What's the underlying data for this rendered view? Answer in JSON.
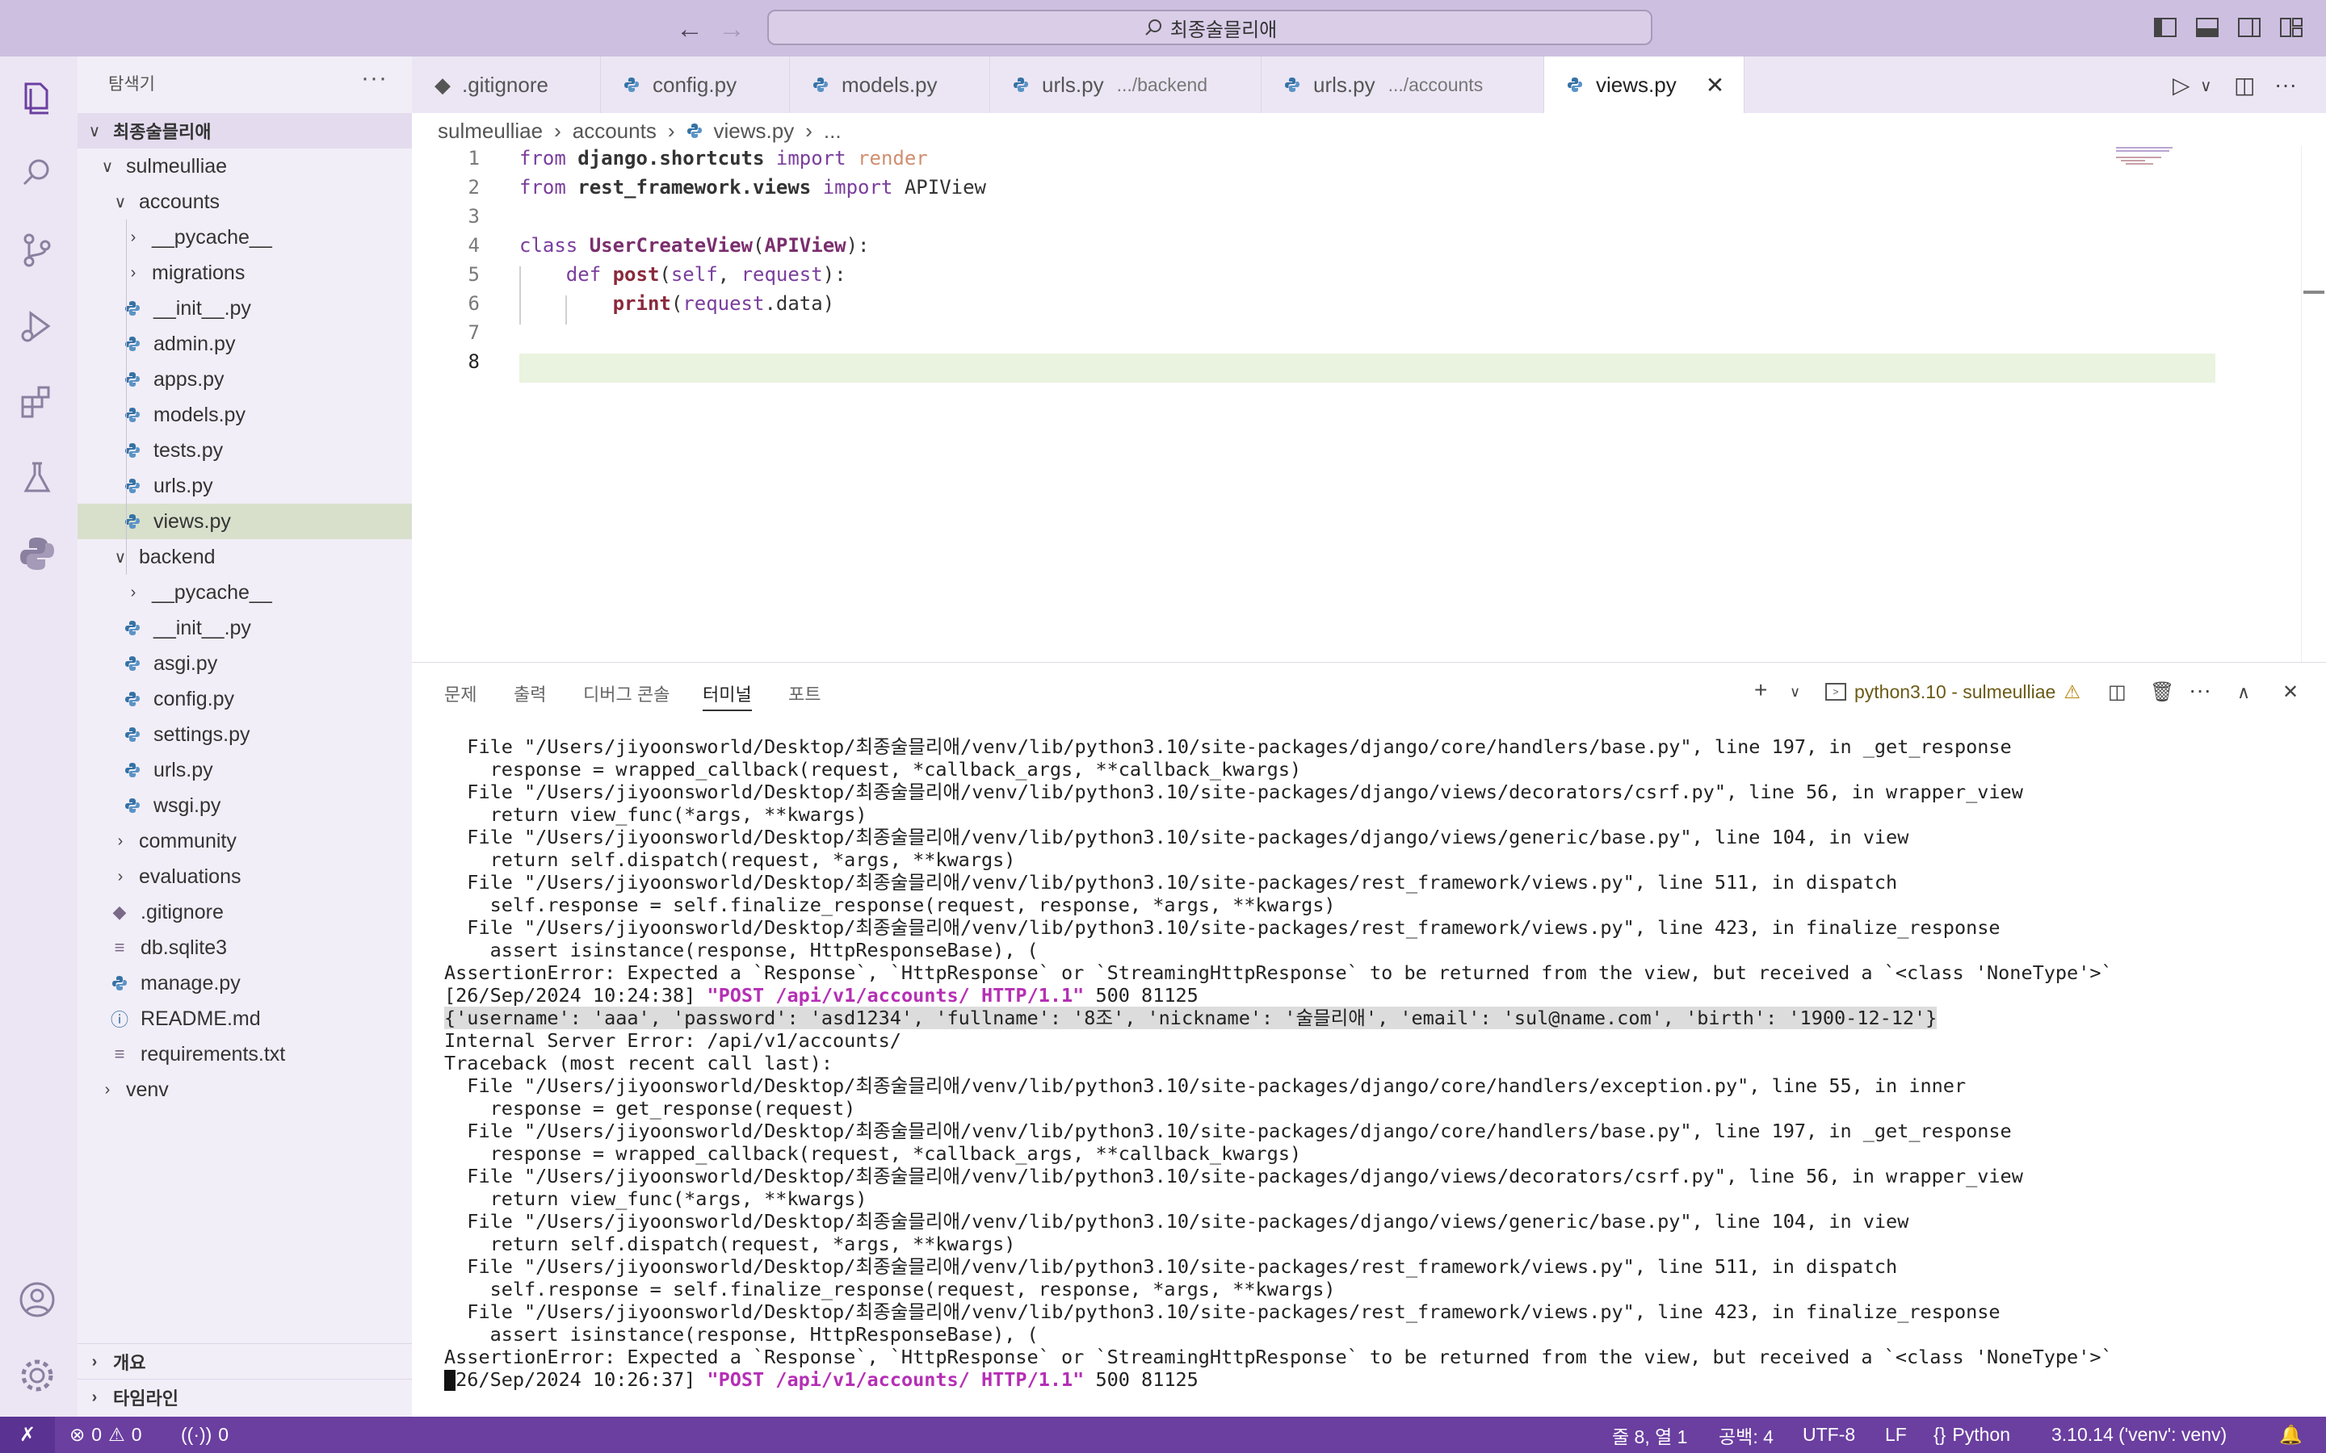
{
  "titlebar": {
    "search_text": "최종술믈리애"
  },
  "sidebar": {
    "title": "탐색기",
    "root": "최종술믈리애",
    "tree": [
      {
        "label": "sulmeulliae",
        "kind": "folder-open",
        "depth": 1
      },
      {
        "label": "accounts",
        "kind": "folder-open",
        "depth": 2
      },
      {
        "label": "__pycache__",
        "kind": "folder",
        "depth": 3
      },
      {
        "label": "migrations",
        "kind": "folder",
        "depth": 3
      },
      {
        "label": "__init__.py",
        "kind": "py",
        "depth": 3
      },
      {
        "label": "admin.py",
        "kind": "py",
        "depth": 3
      },
      {
        "label": "apps.py",
        "kind": "py",
        "depth": 3
      },
      {
        "label": "models.py",
        "kind": "py",
        "depth": 3
      },
      {
        "label": "tests.py",
        "kind": "py",
        "depth": 3
      },
      {
        "label": "urls.py",
        "kind": "py",
        "depth": 3
      },
      {
        "label": "views.py",
        "kind": "py",
        "depth": 3,
        "selected": true
      },
      {
        "label": "backend",
        "kind": "folder-open",
        "depth": 2
      },
      {
        "label": "__pycache__",
        "kind": "folder",
        "depth": 3
      },
      {
        "label": "__init__.py",
        "kind": "py",
        "depth": 3
      },
      {
        "label": "asgi.py",
        "kind": "py",
        "depth": 3
      },
      {
        "label": "config.py",
        "kind": "py",
        "depth": 3
      },
      {
        "label": "settings.py",
        "kind": "py",
        "depth": 3
      },
      {
        "label": "urls.py",
        "kind": "py",
        "depth": 3
      },
      {
        "label": "wsgi.py",
        "kind": "py",
        "depth": 3
      },
      {
        "label": "community",
        "kind": "folder",
        "depth": 2
      },
      {
        "label": "evaluations",
        "kind": "folder",
        "depth": 2
      },
      {
        "label": ".gitignore",
        "kind": "git",
        "depth": 2
      },
      {
        "label": "db.sqlite3",
        "kind": "db",
        "depth": 2
      },
      {
        "label": "manage.py",
        "kind": "py",
        "depth": 2
      },
      {
        "label": "README.md",
        "kind": "info",
        "depth": 2
      },
      {
        "label": "requirements.txt",
        "kind": "txt",
        "depth": 2
      },
      {
        "label": "venv",
        "kind": "folder",
        "depth": 1
      }
    ],
    "sections": [
      "개요",
      "타임라인"
    ]
  },
  "tabs": [
    {
      "label": ".gitignore",
      "sub": ""
    },
    {
      "label": "config.py",
      "sub": ""
    },
    {
      "label": "models.py",
      "sub": ""
    },
    {
      "label": "urls.py",
      "sub": ".../backend"
    },
    {
      "label": "urls.py",
      "sub": ".../accounts"
    },
    {
      "label": "views.py",
      "sub": "",
      "active": true
    }
  ],
  "breadcrumb": [
    "sulmeulliae",
    "accounts",
    "views.py",
    "..."
  ],
  "editor": {
    "line_numbers": [
      "1",
      "2",
      "3",
      "4",
      "5",
      "6",
      "7",
      "8"
    ],
    "current_line": "8"
  },
  "panel": {
    "tabs": [
      "문제",
      "출력",
      "디버그 콘솔",
      "터미널",
      "포트"
    ],
    "active_tab": "터미널",
    "terminal_name": "python3.10 - sulmeulliae",
    "lines": [
      "  File \"/Users/jiyoonsworld/Desktop/최종술믈리애/venv/lib/python3.10/site-packages/django/core/handlers/base.py\", line 197, in _get_response",
      "    response = wrapped_callback(request, *callback_args, **callback_kwargs)",
      "  File \"/Users/jiyoonsworld/Desktop/최종술믈리애/venv/lib/python3.10/site-packages/django/views/decorators/csrf.py\", line 56, in wrapper_view",
      "    return view_func(*args, **kwargs)",
      "  File \"/Users/jiyoonsworld/Desktop/최종술믈리애/venv/lib/python3.10/site-packages/django/views/generic/base.py\", line 104, in view",
      "    return self.dispatch(request, *args, **kwargs)",
      "  File \"/Users/jiyoonsworld/Desktop/최종술믈리애/venv/lib/python3.10/site-packages/rest_framework/views.py\", line 511, in dispatch",
      "    self.response = self.finalize_response(request, response, *args, **kwargs)",
      "  File \"/Users/jiyoonsworld/Desktop/최종술믈리애/venv/lib/python3.10/site-packages/rest_framework/views.py\", line 423, in finalize_response",
      "    assert isinstance(response, HttpResponseBase), (",
      "AssertionError: Expected a `Response`, `HttpResponse` or `StreamingHttpResponse` to be returned from the view, but received a `<class 'NoneType'>`",
      "",
      "{'username': 'aaa', 'password': 'asd1234', 'fullname': '8조', 'nickname': '술믈리애', 'email': 'sul@name.com', 'birth': '1900-12-12'}",
      "Internal Server Error: /api/v1/accounts/",
      "Traceback (most recent call last):",
      "  File \"/Users/jiyoonsworld/Desktop/최종술믈리애/venv/lib/python3.10/site-packages/django/core/handlers/exception.py\", line 55, in inner",
      "    response = get_response(request)",
      "  File \"/Users/jiyoonsworld/Desktop/최종술믈리애/venv/lib/python3.10/site-packages/django/core/handlers/base.py\", line 197, in _get_response",
      "    response = wrapped_callback(request, *callback_args, **callback_kwargs)",
      "  File \"/Users/jiyoonsworld/Desktop/최종술믈리애/venv/lib/python3.10/site-packages/django/views/decorators/csrf.py\", line 56, in wrapper_view",
      "    return view_func(*args, **kwargs)",
      "  File \"/Users/jiyoonsworld/Desktop/최종술믈리애/venv/lib/python3.10/site-packages/django/views/generic/base.py\", line 104, in view",
      "    return self.dispatch(request, *args, **kwargs)",
      "  File \"/Users/jiyoonsworld/Desktop/최종술믈리애/venv/lib/python3.10/site-packages/rest_framework/views.py\", line 511, in dispatch",
      "    self.response = self.finalize_response(request, response, *args, **kwargs)",
      "  File \"/Users/jiyoonsworld/Desktop/최종술믈리애/venv/lib/python3.10/site-packages/rest_framework/views.py\", line 423, in finalize_response",
      "    assert isinstance(response, HttpResponseBase), (",
      "AssertionError: Expected a `Response`, `HttpResponse` or `StreamingHttpResponse` to be returned from the view, but received a `<class 'NoneType'>`",
      ""
    ],
    "requests": [
      {
        "ts": "[26/Sep/2024 10:24:38] ",
        "req": "\"POST /api/v1/accounts/ HTTP/1.1\"",
        "tail": " 500 81125"
      },
      {
        "ts": "[26/Sep/2024 10:26:37] ",
        "req": "\"POST /api/v1/accounts/ HTTP/1.1\"",
        "tail": " 500 81125"
      }
    ]
  },
  "statusbar": {
    "errors": "0",
    "warnings": "0",
    "ports": "0",
    "position": "줄 8, 열 1",
    "spaces": "공백: 4",
    "encoding": "UTF-8",
    "eol": "LF",
    "language": "Python",
    "interpreter": "3.10.14 ('venv': venv)"
  },
  "colors": {
    "accent": "#6a3fa0",
    "titlebar": "#cdbfe0",
    "request_text": "#b52fb5"
  }
}
